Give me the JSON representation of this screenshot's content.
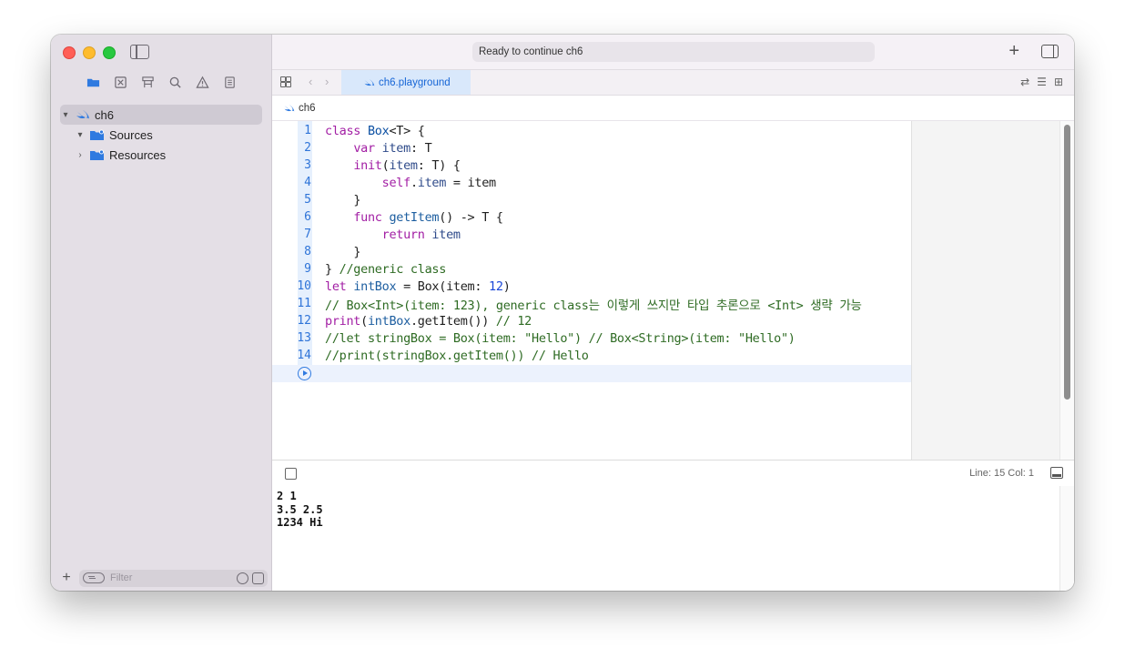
{
  "window": {
    "activity_status": "Ready to continue ch6"
  },
  "sidebar": {
    "tree": [
      {
        "label": "ch6",
        "expanded": true,
        "selected": true
      },
      {
        "label": "Sources",
        "expanded": true
      },
      {
        "label": "Resources",
        "expanded": false
      }
    ],
    "filter_placeholder": "Filter"
  },
  "tabs": [
    {
      "label": "ch6.playground",
      "active": true
    }
  ],
  "jumpbar": {
    "path": "ch6"
  },
  "editor": {
    "lines": [
      {
        "n": "1"
      },
      {
        "n": "2"
      },
      {
        "n": "3"
      },
      {
        "n": "4"
      },
      {
        "n": "5"
      },
      {
        "n": "6"
      },
      {
        "n": "7"
      },
      {
        "n": "8"
      },
      {
        "n": "9"
      },
      {
        "n": "10"
      },
      {
        "n": "11"
      },
      {
        "n": "12"
      },
      {
        "n": "13"
      },
      {
        "n": "14"
      }
    ],
    "code": {
      "l1_kw": "class",
      "l1_ty": "Box",
      "l1_rest": "<T> {",
      "l2_kw": "var",
      "l2_prop": "item",
      "l2_rest": ": T",
      "l3_kw": "init",
      "l3_open": "(",
      "l3_prop": "item",
      "l3_rest": ": T) {",
      "l4_kw": "self",
      "l4_dot": ".",
      "l4_prop": "item",
      "l4_rest": " = item",
      "l5": "}",
      "l6_kw": "func",
      "l6_fn": "getItem",
      "l6_rest": "() -> T {",
      "l7_kw": "return",
      "l7_id": "item",
      "l8": "}",
      "l9_code": "} ",
      "l9_cm": "//generic class",
      "l10_kw": "let",
      "l10_id": "intBox",
      "l10_mid": " = Box(item: ",
      "l10_num": "12",
      "l10_end": ")",
      "l11_cm": "// Box<Int>(item: 123), generic class는 이렇게 쓰지만 타입 추론으로 <Int> 생략 가능",
      "l12_kw": "print",
      "l12_open": "(",
      "l12_id": "intBox",
      "l12_rest": ".getItem()) ",
      "l12_cm": "// 12",
      "l13_cm": "//let stringBox = Box(item: \"Hello\") // Box<String>(item: \"Hello\")",
      "l14_cm": "//print(stringBox.getItem()) // Hello"
    }
  },
  "debug_bar": {
    "cursor_position": "Line: 15  Col: 1"
  },
  "console": {
    "output": "2 1\n3.5 2.5\n1234 Hi"
  },
  "colors": {
    "keyword": "#a21ea4",
    "type": "#0b4fa2",
    "number": "#1a47d8",
    "comment": "#2e6b23",
    "accent": "#1565d6"
  }
}
